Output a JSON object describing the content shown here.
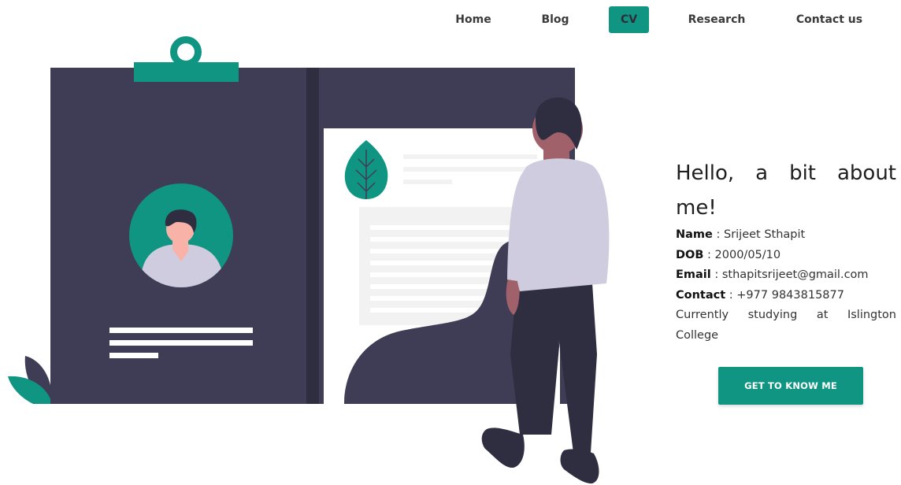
{
  "nav": {
    "items": [
      {
        "label": "Home"
      },
      {
        "label": "Blog"
      },
      {
        "label": "CV",
        "active": true
      },
      {
        "label": "Research"
      },
      {
        "label": "Contact us"
      }
    ]
  },
  "about": {
    "title": "Hello, a bit about me!",
    "name_label": "Name",
    "name_value": "Srijeet Sthapit",
    "dob_label": "DOB",
    "dob_value": "2000/05/10",
    "email_label": "Email",
    "email_value": "sthapitsrijeet@gmail.com",
    "contact_label": "Contact",
    "contact_value": "+977 9843815877",
    "bio": "Currently studying at Islington College"
  },
  "cta": {
    "label": "GET TO KNOW ME"
  },
  "colors": {
    "accent": "#0f9582",
    "dark": "#3f3d56",
    "light_gray": "#f2f2f2",
    "shirt": "#cfcce0"
  },
  "icons": {
    "illustration": "resume-illustration",
    "leaf": "leaf-icon",
    "avatar": "avatar-icon",
    "clipboard_clip": "clip-icon"
  }
}
